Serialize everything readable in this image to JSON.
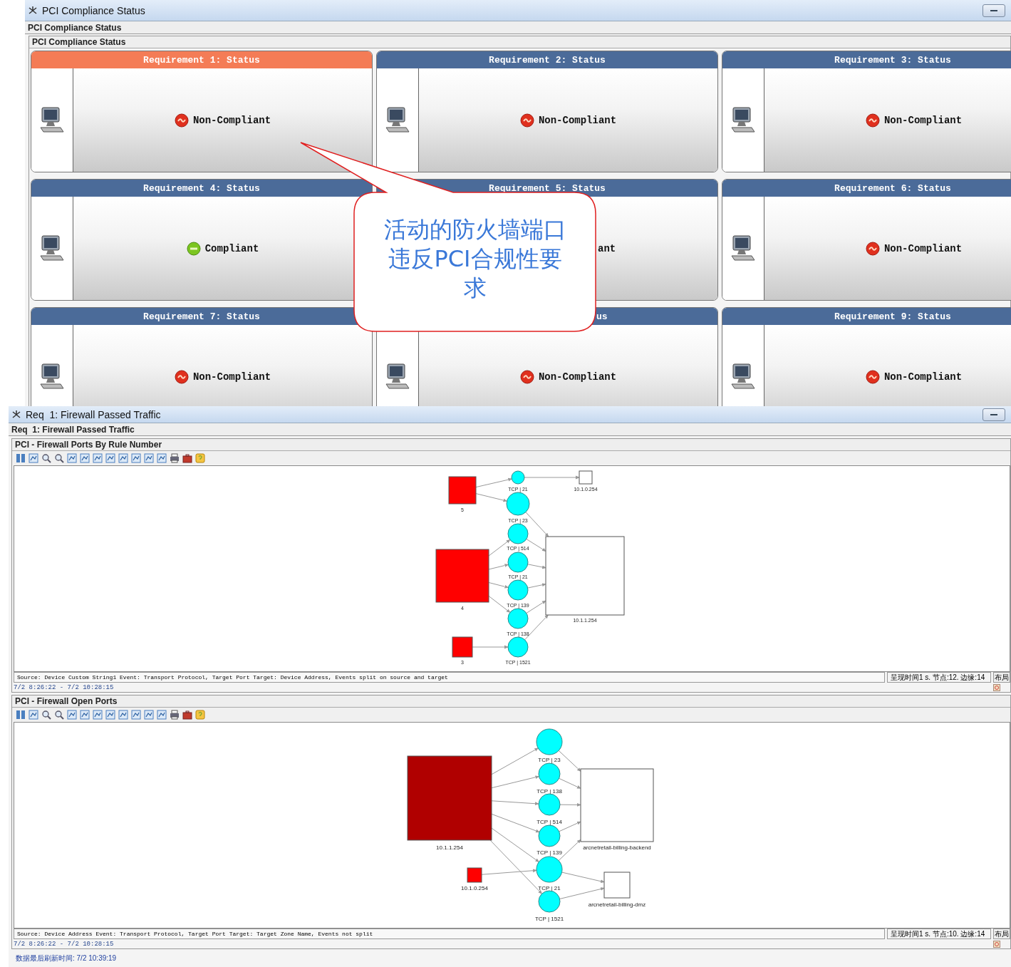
{
  "top_window": {
    "title": "PCI Compliance Status",
    "tab": "PCI Compliance Status",
    "panel_title": "PCI Compliance Status",
    "cards": [
      {
        "title": "Requirement 1: Status",
        "selected": true,
        "compliant": false,
        "status": "Non-Compliant"
      },
      {
        "title": "Requirement 2: Status",
        "selected": false,
        "compliant": false,
        "status": "Non-Compliant"
      },
      {
        "title": "Requirement 3: Status",
        "selected": false,
        "compliant": false,
        "status": "Non-Compliant"
      },
      {
        "title": "Requirement 4: Status",
        "selected": false,
        "compliant": true,
        "status": "Compliant"
      },
      {
        "title": "Requirement 5: Status",
        "selected": false,
        "status": "ant",
        "status_covered": true
      },
      {
        "title": "Requirement 6: Status",
        "selected": false,
        "compliant": false,
        "status": "Non-Compliant"
      },
      {
        "title": "Requirement 7: Status",
        "selected": false,
        "compliant": false,
        "status": "Non-Compliant"
      },
      {
        "title": "us",
        "title_covered": true,
        "selected": false,
        "compliant": false,
        "status": "Non-Compliant"
      },
      {
        "title": "Requirement 9: Status",
        "selected": false,
        "compliant": false,
        "status": "Non-Compliant"
      }
    ],
    "callout": {
      "text": "活动的防火墙端口违反PCI合规性要求"
    }
  },
  "bottom_window": {
    "title": "Req  1: Firewall Passed Traffic",
    "tab": "Req  1: Firewall Passed Traffic",
    "sections": [
      {
        "title": "PCI - Firewall Ports By Rule Number",
        "nodes": [
          {
            "label": "5",
            "kind": "square",
            "color": "#ff0000"
          },
          {
            "label": "4",
            "kind": "square",
            "color": "#ff0000"
          },
          {
            "label": "3",
            "kind": "square",
            "color": "#ff0000"
          },
          {
            "label": "TCP | 21",
            "kind": "circle",
            "color": "#00ffff"
          },
          {
            "label": "TCP | 23",
            "kind": "circle",
            "color": "#00ffff"
          },
          {
            "label": "TCP | 514",
            "kind": "circle",
            "color": "#00ffff"
          },
          {
            "label": "TCP | 21",
            "kind": "circle",
            "color": "#00ffff"
          },
          {
            "label": "TCP | 139",
            "kind": "circle",
            "color": "#00ffff"
          },
          {
            "label": "TCP | 138",
            "kind": "circle",
            "color": "#00ffff"
          },
          {
            "label": "TCP | 1521",
            "kind": "circle",
            "color": "#00ffff"
          },
          {
            "label": "10.1.0.254",
            "kind": "square",
            "color": "#ffffff"
          },
          {
            "label": "10.1.1.254",
            "kind": "square",
            "color": "#ffffff"
          }
        ],
        "source": "Source: Device Custom String1 Event: Transport Protocol, Target Port Target: Device Address, Events split on source and target",
        "stats": "呈现时间1 s. 节点:12. 边缘:14",
        "layout": "布局",
        "range": "7/2 8:26:22 - 7/2 10:28:15"
      },
      {
        "title": "PCI - Firewall Open Ports",
        "nodes": [
          {
            "label": "10.1.1.254",
            "kind": "square",
            "color": "#b00000"
          },
          {
            "label": "10.1.0.254",
            "kind": "square",
            "color": "#ff0000"
          },
          {
            "label": "TCP | 23",
            "kind": "circle",
            "color": "#00ffff"
          },
          {
            "label": "TCP | 138",
            "kind": "circle",
            "color": "#00ffff"
          },
          {
            "label": "TCP | 514",
            "kind": "circle",
            "color": "#00ffff"
          },
          {
            "label": "TCP | 139",
            "kind": "circle",
            "color": "#00ffff"
          },
          {
            "label": "TCP | 21",
            "kind": "circle",
            "color": "#00ffff"
          },
          {
            "label": "TCP | 1521",
            "kind": "circle",
            "color": "#00ffff"
          },
          {
            "label": "arcnetretail-billing-backend",
            "kind": "square",
            "color": "#ffffff"
          },
          {
            "label": "arcnetretail-billing-dmz",
            "kind": "square",
            "color": "#ffffff"
          }
        ],
        "source": "Source: Device Address Event: Transport Protocol, Target Port Target: Target Zone Name, Events not split",
        "stats": "呈现时间1 s. 节点:10. 边缘:14",
        "layout": "布局",
        "range": "7/2 8:26:22 - 7/2 10:28:15"
      }
    ],
    "footer": "数据最后刷新时间: 7/2 10:39:19"
  }
}
